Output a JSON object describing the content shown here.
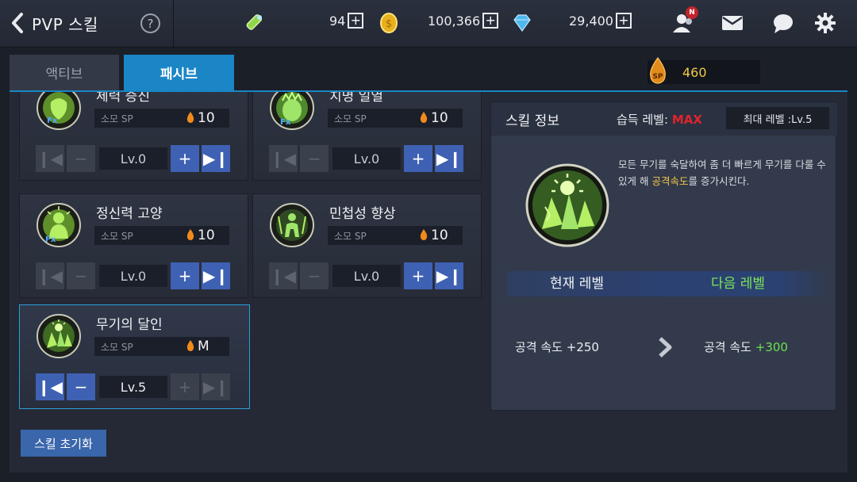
{
  "header": {
    "title": "PVP 스킬",
    "help": "?",
    "currencies": [
      {
        "icon": "energy-icon",
        "value": "94"
      },
      {
        "icon": "gold-coin-icon",
        "value": "100,366"
      },
      {
        "icon": "diamond-icon",
        "value": "29,400"
      }
    ],
    "friends_badge": "N"
  },
  "tabs": {
    "active_label": "액티브",
    "passive_label": "패시브"
  },
  "sp_total": "460",
  "skills": [
    {
      "name": "체력 증진",
      "sp_label": "소모 SP",
      "cost": "10",
      "level": "Lv.0"
    },
    {
      "name": "치명 일열",
      "sp_label": "소모 SP",
      "cost": "10",
      "level": "Lv.0"
    },
    {
      "name": "정신력 고양",
      "sp_label": "소모 SP",
      "cost": "10",
      "level": "Lv.0"
    },
    {
      "name": "민첩성 향상",
      "sp_label": "소모 SP",
      "cost": "10",
      "level": "Lv.0"
    },
    {
      "name": "무기의 달인",
      "sp_label": "소모 SP",
      "cost": "M",
      "level": "Lv.5"
    }
  ],
  "reset_label": "스킬 초기화",
  "info": {
    "title": "스킬 정보",
    "acquired_label": "습득 레벨:",
    "acquired_value": "MAX",
    "max_level": "최대 레벨 :Lv.5",
    "desc_part1": "모든 무기를 숙달하여 좀 더 빠르게 무기를 다룰 수 있게 해 ",
    "desc_highlight": "공격속도",
    "desc_part2": "를 증가시킨다.",
    "current_label": "현재 레벨",
    "next_label": "다음 레벨",
    "current_stat_name": "공격 속도",
    "current_stat_value": "+250",
    "next_stat_name": "공격 속도",
    "next_stat_value": "+300"
  },
  "colors": {
    "accent": "#1a86c6",
    "sp": "#f3c94a",
    "max": "#e0242e",
    "next": "#7ee65a",
    "button": "#3f61b3"
  }
}
